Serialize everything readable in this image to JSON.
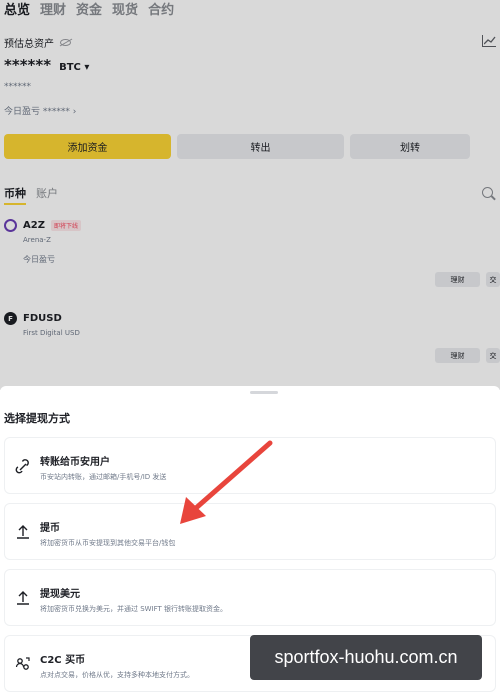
{
  "top_tabs": [
    "总览",
    "理财",
    "资金",
    "现货",
    "合约"
  ],
  "header": {
    "estimated_label": "预估总资产",
    "balance_mask": "******",
    "currency": "BTC ▾",
    "sub_mask": "******",
    "today_pnl": "今日盈亏 ****** ›"
  },
  "actions": {
    "deposit": "添加资金",
    "withdraw": "转出",
    "transfer": "划转"
  },
  "list_tabs": [
    "币种",
    "账户"
  ],
  "assets": [
    {
      "symbol": "A2Z",
      "badge": "即将下线",
      "name": "Arena-Z",
      "pnl_label": "今日盈亏",
      "buttons": [
        "理财",
        "交"
      ]
    },
    {
      "symbol": "FDUSD",
      "name": "First Digital USD",
      "buttons": [
        "理财",
        "交"
      ]
    }
  ],
  "sheet": {
    "title": "选择提现方式",
    "options": [
      {
        "icon": "transfer-user-icon",
        "title": "转账给币安用户",
        "desc": "币安站内转账，通过邮箱/手机号/ID 发送"
      },
      {
        "icon": "upload-icon",
        "title": "提币",
        "desc": "将加密货币从币安提现到其他交易平台/钱包"
      },
      {
        "icon": "upload-icon",
        "title": "提现美元",
        "desc": "将加密货币兑换为美元，并通过 SWIFT 银行转账提取资金。"
      },
      {
        "icon": "p2p-icon",
        "title": "C2C 买币",
        "desc": "点对点交易，价格从优，支持多种本地支付方式。"
      }
    ]
  },
  "watermark": "sportfox-huohu.com.cn",
  "colors": {
    "brand_yellow": "#fcd535",
    "arrow_red": "#e8453c"
  }
}
